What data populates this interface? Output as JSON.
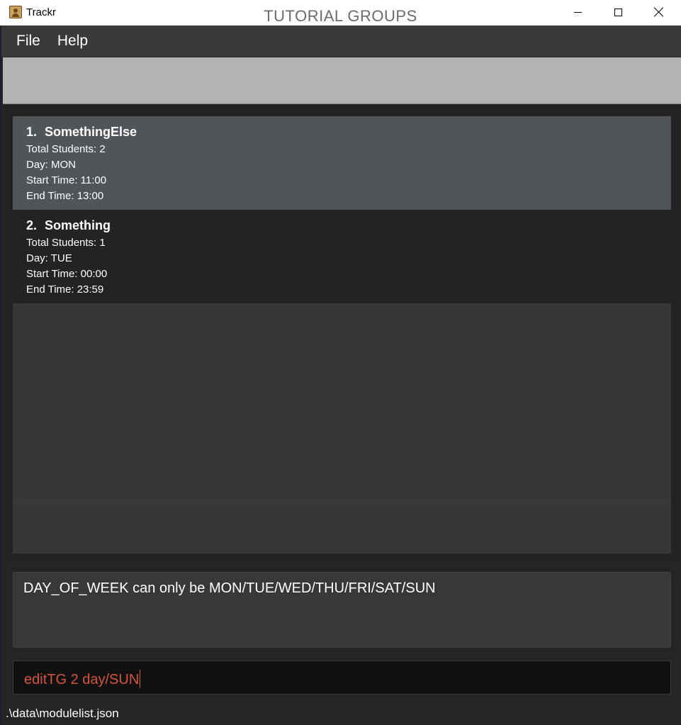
{
  "window": {
    "title": "Trackr",
    "icon": "app-icon"
  },
  "menu": {
    "items": [
      {
        "label": "File"
      },
      {
        "label": "Help"
      }
    ]
  },
  "panel": {
    "title": "TUTORIAL GROUPS"
  },
  "groups": [
    {
      "index": "1.",
      "name": "SomethingElse",
      "total_students": "Total Students: 2",
      "day": "Day: MON",
      "start_time": "Start Time: 11:00",
      "end_time": "End Time: 13:00",
      "selected": true
    },
    {
      "index": "2.",
      "name": "Something",
      "total_students": "Total Students: 1",
      "day": "Day: TUE",
      "start_time": "Start Time: 00:00",
      "end_time": "End Time: 23:59",
      "selected": false
    }
  ],
  "result": {
    "message": "DAY_OF_WEEK can only be MON/TUE/WED/THU/FRI/SAT/SUN"
  },
  "command": {
    "value": "editTG 2 day/SUN"
  },
  "status": {
    "path": ".\\data\\modulelist.json"
  },
  "colors": {
    "selected_card": "#50555a",
    "command_error_text": "#d2553c",
    "header_bg": "#b3b3b3"
  }
}
